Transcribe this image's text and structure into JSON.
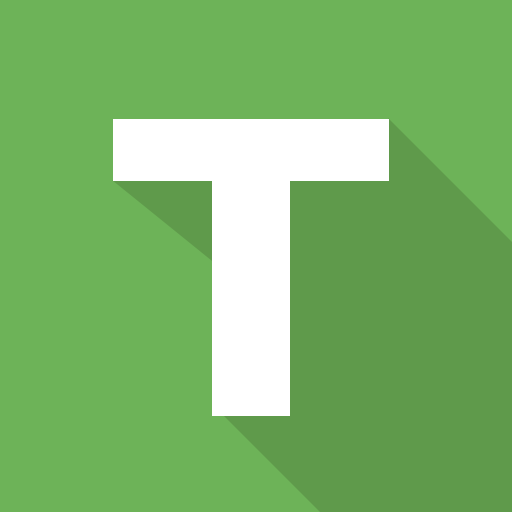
{
  "icon": {
    "name": "letter-t-icon",
    "letter": "T",
    "colors": {
      "background": "#6db358",
      "long_shadow": "#5f9a4b",
      "glyph": "#ffffff"
    }
  }
}
